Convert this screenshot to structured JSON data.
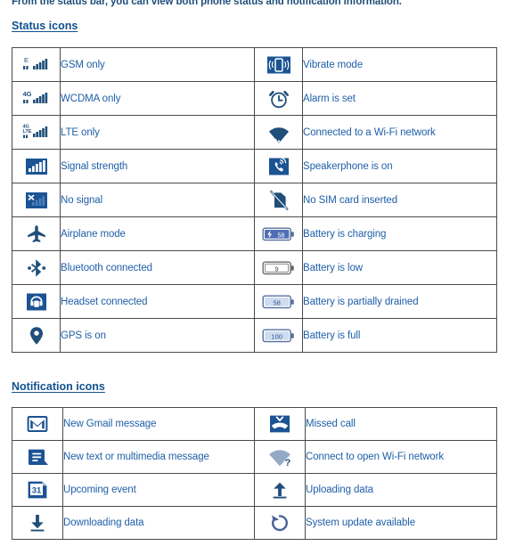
{
  "intro": {
    "text": "From the status bar, you can view both phone status and notification information."
  },
  "colors": {
    "text_blue": "#1f5fa8",
    "heading_blue": "#11518f",
    "icon_dark_blue": "#1f4e79",
    "icon_fill_blue": "#1b5394",
    "border_gray": "#4a4a4a"
  },
  "sections": [
    {
      "id": "status",
      "heading": "Status icons",
      "rows": [
        [
          {
            "icon": "gsm-only-icon",
            "label": "GSM only"
          },
          {
            "icon": "vibrate-mode-icon",
            "label": "Vibrate mode"
          }
        ],
        [
          {
            "icon": "wcdma-only-icon",
            "label": "WCDMA only"
          },
          {
            "icon": "alarm-set-icon",
            "label": "Alarm is set"
          }
        ],
        [
          {
            "icon": "lte-only-icon",
            "label": "LTE only"
          },
          {
            "icon": "wifi-connected-icon",
            "label": "Connected to a Wi-Fi network"
          }
        ],
        [
          {
            "icon": "signal-strength-icon",
            "label": "Signal strength"
          },
          {
            "icon": "speakerphone-on-icon",
            "label": "Speakerphone is on"
          }
        ],
        [
          {
            "icon": "no-signal-icon",
            "label": "No signal"
          },
          {
            "icon": "no-sim-card-icon",
            "label": "No SIM card inserted"
          }
        ],
        [
          {
            "icon": "airplane-mode-icon",
            "label": "Airplane mode"
          },
          {
            "icon": "battery-charging-icon",
            "label": "Battery is charging",
            "battery_value": "58"
          }
        ],
        [
          {
            "icon": "bluetooth-connected-icon",
            "label": "Bluetooth connected"
          },
          {
            "icon": "battery-low-icon",
            "label": "Battery is low",
            "battery_value": "9"
          }
        ],
        [
          {
            "icon": "headset-connected-icon",
            "label": "Headset connected"
          },
          {
            "icon": "battery-partial-icon",
            "label": "Battery is partially drained",
            "battery_value": "58"
          }
        ],
        [
          {
            "icon": "gps-on-icon",
            "label": "GPS is on"
          },
          {
            "icon": "battery-full-icon",
            "label": "Battery is full",
            "battery_value": "100"
          }
        ]
      ]
    },
    {
      "id": "notif",
      "heading": "Notification icons",
      "rows": [
        [
          {
            "icon": "new-gmail-message-icon",
            "label": "New Gmail message"
          },
          {
            "icon": "missed-call-icon",
            "label": "Missed call"
          }
        ],
        [
          {
            "icon": "new-text-message-icon",
            "label": "New text or multimedia message"
          },
          {
            "icon": "open-wifi-network-icon",
            "label": "Connect to open Wi-Fi network"
          }
        ],
        [
          {
            "icon": "upcoming-event-icon",
            "label": "Upcoming event",
            "calendar_day": "31"
          },
          {
            "icon": "uploading-data-icon",
            "label": "Uploading data"
          }
        ],
        [
          {
            "icon": "downloading-data-icon",
            "label": "Downloading data"
          },
          {
            "icon": "system-update-icon",
            "label": "System update available"
          }
        ]
      ]
    }
  ]
}
